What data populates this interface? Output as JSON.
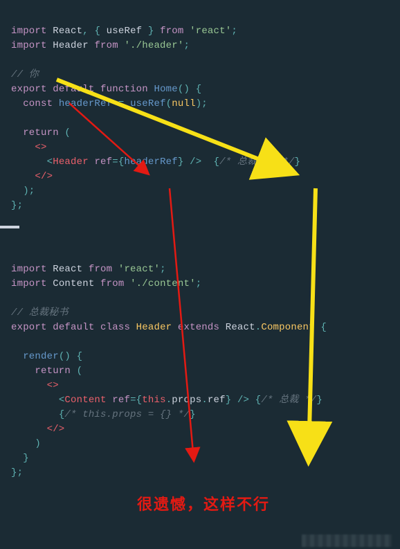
{
  "code": {
    "l1_import": "import",
    "l1_react": "React",
    "l1_useref": "useRef",
    "l1_from": "from",
    "l1_reactmod": "'react'",
    "l2_header": "Header",
    "l2_headermod": "'./header'",
    "l4_comment": "// 你",
    "l5_export": "export",
    "l5_default": "default",
    "l5_function": "function",
    "l5_home": "Home",
    "l6_const": "const",
    "l6_headerref": "headerRef",
    "l6_useref": "useRef",
    "l6_null": "null",
    "l8_return": "return",
    "l9_frag_open": "<>",
    "l10_tag": "Header",
    "l10_attr": "ref",
    "l10_headerref": "headerRef",
    "l10_comment": "/* 总裁秘书 */",
    "l11_frag_close": "</>",
    "l17_import": "import",
    "l17_react": "React",
    "l17_from": "from",
    "l17_reactmod": "'react'",
    "l18_content": "Content",
    "l18_contentmod": "'./content'",
    "l20_comment": "// 总裁秘书",
    "l21_export": "export",
    "l21_default": "default",
    "l21_class": "class",
    "l21_header": "Header",
    "l21_extends": "extends",
    "l21_react": "React",
    "l21_component": "Component",
    "l23_render": "render",
    "l24_return": "return",
    "l25_frag_open": "<>",
    "l26_tag": "Content",
    "l26_attr": "ref",
    "l26_this": "this",
    "l26_props": "props",
    "l26_ref": "ref",
    "l26_comment": "/* 总裁 */",
    "l27_comment": "/* this.props = {} */",
    "l28_frag_close": "</>"
  },
  "caption": "很遗憾，这样不行"
}
